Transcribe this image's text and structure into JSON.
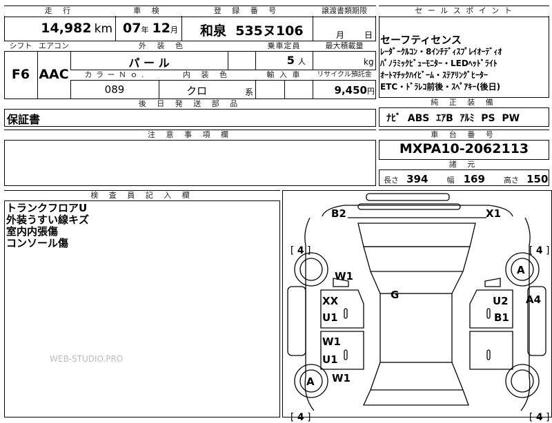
{
  "top": {
    "mileage_label": "走 行",
    "mileage_value": "14,982",
    "mileage_unit": "km",
    "inspection_label": "車 検",
    "inspection_year": "07",
    "inspection_year_unit": "年",
    "inspection_month": "12",
    "inspection_month_unit": "月",
    "registration_label": "登 録 番 号",
    "registration_value": "和泉  535ヌ106",
    "transfer_label": "譲渡書類期限",
    "transfer_month_unit": "月",
    "transfer_day_unit": "日"
  },
  "specs": {
    "shift_label": "シフト",
    "shift_value": "F6",
    "aircon_label": "エアコン",
    "aircon_value": "AAC",
    "exterior_color_label": "外 装 色",
    "exterior_color_value": "パ ー ル",
    "color_no_label": "カ ラ ー Ｎ ｏ .",
    "color_no_value": "089",
    "interior_color_label": "内 装 色",
    "interior_color_value": "クロ",
    "interior_color_suffix": "系",
    "capacity_label": "乗車定員",
    "capacity_value": "5",
    "capacity_unit": "人",
    "max_load_label": "最大積載量",
    "max_load_unit": "kg",
    "import_label": "輸 入 車",
    "recycle_label": "リサイクル預託金",
    "recycle_value": "9,450",
    "recycle_unit": "円"
  },
  "sales_points": {
    "label": "セ ー ル ス ポ イ ン ト",
    "lines": [
      "セーフティセンス",
      "ﾚｰﾀﾞｰｸﾙｺﾝ・8ｲﾝﾁﾃﾞｨｽﾌﾟﾚｲｵｰﾃﾞｨｵ",
      "ﾊﾟﾉﾗﾐｯｸﾋﾞｭｰﾓﾆﾀｰ・LEDﾍｯﾄﾞﾗｲﾄ",
      "ｵｰﾄﾏﾁｯｸﾊｲﾋﾞｰﾑ・ｽﾃｱﾘﾝｸﾞﾋｰﾀｰ",
      "ETC・ﾄﾞﾗﾚｺ前後・ｽﾍﾟｱｷｰ(後日)"
    ]
  },
  "later_parts": {
    "label": "後 日 発 送 部 品",
    "value": "保証書"
  },
  "standard_equipment": {
    "label": "純 正 装 備",
    "value": "ﾅﾋﾞ  ABS  ｴｱB  ｱﾙﾐ  PS  PW"
  },
  "caution": {
    "label": "注 意 事 項 欄"
  },
  "chassis": {
    "label": "車 台 番 号",
    "value": "MXPA10-2062113"
  },
  "dimensions": {
    "label": "諸 元",
    "length_label": "長さ",
    "length_value": "394",
    "width_label": "幅",
    "width_value": "169",
    "height_label": "高さ",
    "height_value": "150"
  },
  "inspector": {
    "label": "検 査 員 記 入 欄",
    "notes": [
      "トランクフロアU",
      "外装うすい線キズ",
      "室内内張傷",
      "コンソール傷"
    ]
  },
  "watermark": "WEB-STUDIO.PRO",
  "diagram": {
    "marks": {
      "b2": "B2",
      "x1": "X1",
      "w1_top": "W1",
      "a_right": "A",
      "g": "G",
      "xx": "XX",
      "u1_a": "U1",
      "u2": "U2",
      "b1": "B1",
      "a4": "A4",
      "w1_mid": "W1",
      "u1_b": "U1",
      "a_left": "A",
      "w1_bot": "W1"
    },
    "tires": {
      "front_left": "4",
      "front_right": "4",
      "rear_left": "4",
      "rear_right": "4"
    },
    "bracket_open": "[",
    "bracket_close": "]"
  }
}
